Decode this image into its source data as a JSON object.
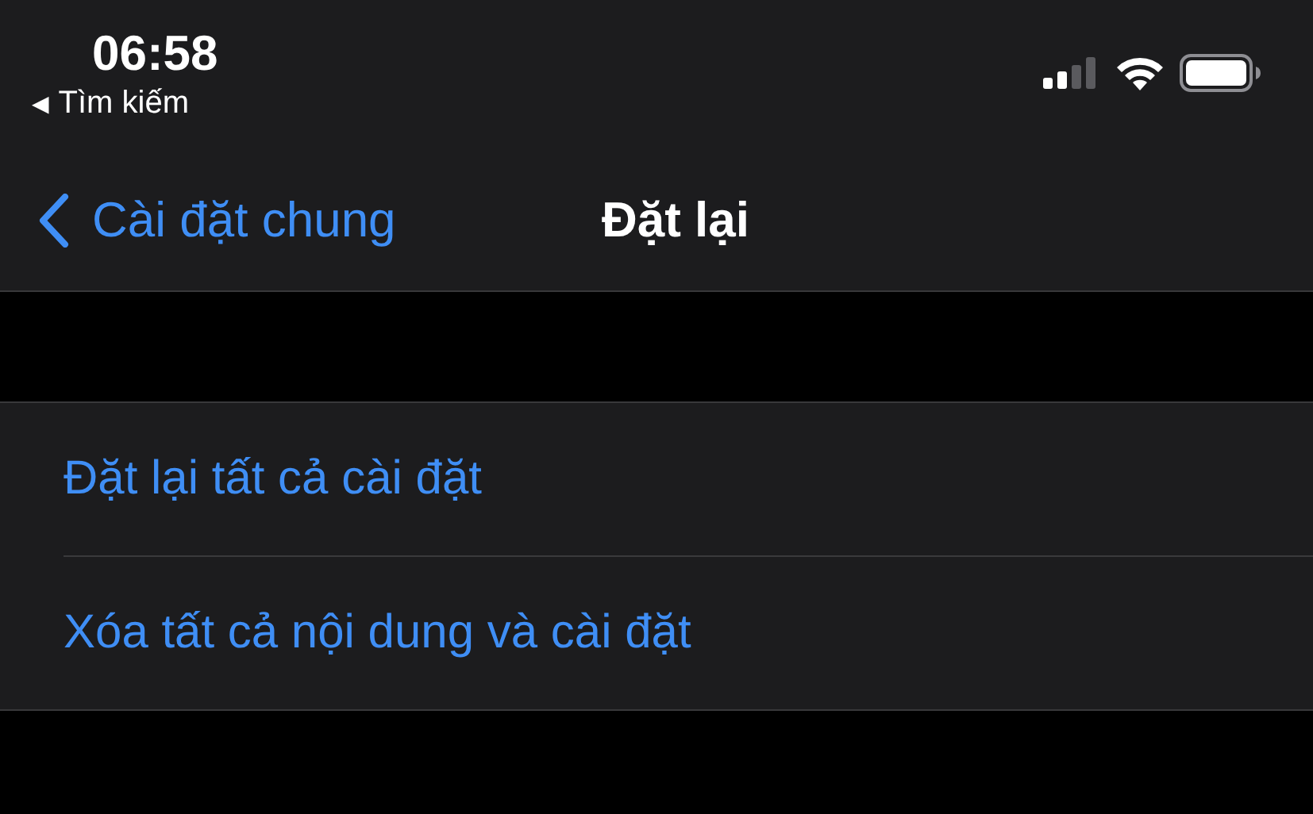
{
  "status_bar": {
    "time": "06:58",
    "back_app": {
      "glyph": "◀",
      "label": "Tìm kiếm"
    }
  },
  "nav_bar": {
    "back_label": "Cài đặt chung",
    "title": "Đặt lại"
  },
  "items": [
    {
      "label": "Đặt lại tất cả cài đặt"
    },
    {
      "label": "Xóa tất cả nội dung và cài đặt"
    }
  ]
}
